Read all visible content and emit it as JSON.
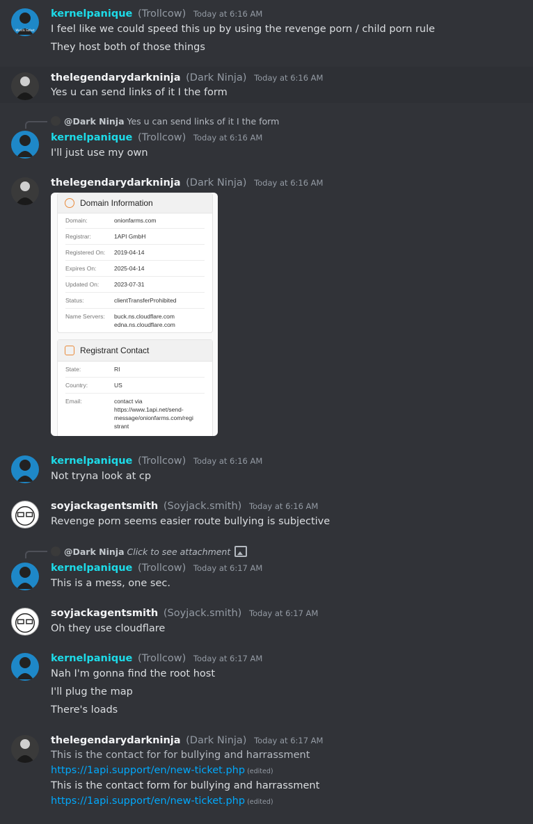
{
  "users": {
    "kernel": {
      "name": "kernelpanique",
      "nick": "(Trollcow)"
    },
    "ninja": {
      "name": "thelegendarydarkninja",
      "nick": "(Dark Ninja)"
    },
    "soy": {
      "name": "soyjackagentsmith",
      "nick": "(Soyjack.smith)"
    }
  },
  "m1": {
    "time": "Today at 6:16 AM",
    "lines": [
      "I feel like we could speed this up by using the revenge porn / child porn rule",
      "They host both of those things"
    ]
  },
  "m2": {
    "time": "Today at 6:16 AM",
    "lines": [
      "Yes u can send links of it I the form"
    ]
  },
  "m3": {
    "reply_mention": "@Dark Ninja",
    "reply_text": "Yes u can send links of it I the form",
    "time": "Today at 6:16 AM",
    "lines": [
      "I'll just use my own"
    ]
  },
  "m4": {
    "time": "Today at 6:16 AM",
    "domain_card": {
      "title": "Domain Information",
      "rows": [
        {
          "label": "Domain:",
          "value": "onionfarms.com"
        },
        {
          "label": "Registrar:",
          "value": "1API GmbH"
        },
        {
          "label": "Registered On:",
          "value": "2019-04-14"
        },
        {
          "label": "Expires On:",
          "value": "2025-04-14"
        },
        {
          "label": "Updated On:",
          "value": "2023-07-31"
        },
        {
          "label": "Status:",
          "value": "clientTransferProhibited"
        },
        {
          "label": "Name Servers:",
          "value": "buck.ns.cloudflare.com",
          "value2": "edna.ns.cloudflare.com"
        }
      ]
    },
    "registrant_card": {
      "title": "Registrant Contact",
      "rows": [
        {
          "label": "State:",
          "value": "RI"
        },
        {
          "label": "Country:",
          "value": "US"
        },
        {
          "label": "Email:",
          "value": "contact via",
          "value2": "https://www.1api.net/send-",
          "value3": "message/onionfarms.com/regi",
          "value4": "strant"
        }
      ]
    }
  },
  "m5": {
    "time": "Today at 6:16 AM",
    "lines": [
      "Not tryna look at cp"
    ]
  },
  "m6": {
    "time": "Today at 6:16 AM",
    "lines": [
      "Revenge porn seems easier route bullying is subjective"
    ]
  },
  "m7": {
    "reply_mention": "@Dark Ninja",
    "reply_text": "Click to see attachment",
    "time": "Today at 6:17 AM",
    "lines": [
      "This is a mess, one sec."
    ]
  },
  "m8": {
    "time": "Today at 6:17 AM",
    "lines": [
      "Oh they use cloudflare"
    ]
  },
  "m9": {
    "time": "Today at 6:17 AM",
    "lines": [
      "Nah I'm gonna find the root host",
      "I'll plug the map",
      "There's loads"
    ]
  },
  "m10": {
    "time": "Today at 6:17 AM",
    "line1": "This is the contact for for bullying and harrassment",
    "link1": "https://1api.support/en/new-ticket.php",
    "edited": "(edited)",
    "line2": "This is the contact form for bullying and harrassment",
    "link2": "https://1api.support/en/new-ticket.php"
  },
  "colors": {
    "background": "#313338",
    "kernel_name": "#1ddbe8",
    "link": "#00a8fc"
  }
}
